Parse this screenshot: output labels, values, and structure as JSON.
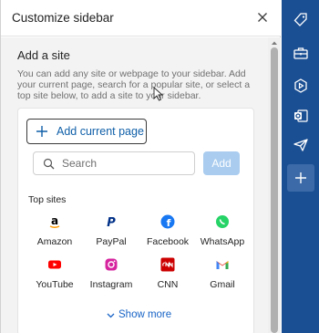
{
  "header": {
    "title": "Customize sidebar",
    "close_icon": "close-icon"
  },
  "add_site": {
    "title": "Add a site",
    "description": "You can add any site or webpage to your sidebar. Add your current page, search for a popular site, or select a top site below, to add a site to your sidebar.",
    "add_current_page_label": "Add current page",
    "search_placeholder": "Search",
    "search_value": "",
    "add_button_label": "Add",
    "top_sites_label": "Top sites",
    "top_sites": [
      {
        "name": "Amazon",
        "icon": "amazon-icon",
        "color": "#000000"
      },
      {
        "name": "PayPal",
        "icon": "paypal-icon",
        "color": "#003087"
      },
      {
        "name": "Facebook",
        "icon": "facebook-icon",
        "color": "#1877f2"
      },
      {
        "name": "WhatsApp",
        "icon": "whatsapp-icon",
        "color": "#25d366"
      },
      {
        "name": "YouTube",
        "icon": "youtube-icon",
        "color": "#ff0000"
      },
      {
        "name": "Instagram",
        "icon": "instagram-icon",
        "color": "#d6249f"
      },
      {
        "name": "CNN",
        "icon": "cnn-icon",
        "color": "#cc0000"
      },
      {
        "name": "Gmail",
        "icon": "gmail-icon",
        "color": "#ea4335"
      }
    ],
    "show_more_label": "Show more"
  },
  "rail": {
    "items": [
      "tag-icon",
      "toolbox-icon",
      "games-icon",
      "outlook-icon",
      "send-icon",
      "add-icon"
    ],
    "accent": "#1b4f93"
  }
}
